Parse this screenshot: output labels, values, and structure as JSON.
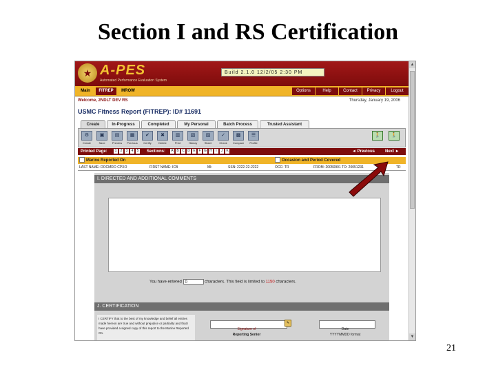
{
  "slide": {
    "title": "Section I and RS Certification",
    "page_number": "21"
  },
  "app": {
    "logo": "A-PES",
    "logo_subtitle": "Automated Performance Evaluation System",
    "build": "Build 2.1.0   12/2/05   2:30 PM"
  },
  "menu": {
    "left_tabs": [
      {
        "label": "Main",
        "bg": "#f0b428",
        "fg": "#000000"
      },
      {
        "label": "FITREP",
        "bg": "#7d0c0c",
        "fg": "#ffffff"
      },
      {
        "label": "MROW",
        "bg": "#f0b428",
        "fg": "#000000"
      }
    ],
    "right_items": [
      "Options",
      "Help",
      "Contact",
      "Privacy",
      "Logout"
    ]
  },
  "welcome": "Welcome, 2NDLT DEV RS",
  "date": "Thursday, January 19, 2006",
  "report_title": "USMC Fitness Report (FITREP): ID# 11691",
  "tabs": [
    {
      "label": "Create",
      "active": true
    },
    {
      "label": "In-Progress",
      "active": false
    },
    {
      "label": "Completed",
      "active": false
    },
    {
      "label": "My Personal",
      "active": false
    },
    {
      "label": "Batch Process",
      "active": false
    },
    {
      "label": "Trusted Assistant",
      "active": false
    }
  ],
  "toolbar": {
    "tools": [
      {
        "icon": "create-icon",
        "glyph": "⚙",
        "label": "Create"
      },
      {
        "icon": "save-icon",
        "glyph": "▣",
        "label": "Save"
      },
      {
        "icon": "preview-icon",
        "glyph": "▤",
        "label": "Preview"
      },
      {
        "icon": "previous-icon",
        "glyph": "▦",
        "label": "Previous"
      },
      {
        "icon": "certify-icon",
        "glyph": "✔",
        "label": "Certify"
      },
      {
        "icon": "delete-icon",
        "glyph": "✖",
        "label": "Delete"
      },
      {
        "icon": "print-icon",
        "glyph": "▥",
        "label": "Print"
      },
      {
        "icon": "history-icon",
        "glyph": "▧",
        "label": "History"
      },
      {
        "icon": "sheet-icon",
        "glyph": "▨",
        "label": "Sheet"
      },
      {
        "icon": "check-icon",
        "glyph": "✓",
        "label": "Check"
      },
      {
        "icon": "compare-icon",
        "glyph": "▩",
        "label": "Compare"
      },
      {
        "icon": "profile-icon",
        "glyph": "☰",
        "label": "Profile"
      }
    ],
    "right_tools": [
      {
        "icon": "walk-left-icon",
        "glyph": "🚶"
      },
      {
        "icon": "walk-right-icon",
        "glyph": "🚶"
      }
    ]
  },
  "navbar": {
    "printed_page_label": "Printed Page:",
    "printed_pages": [
      "1",
      "2",
      "3",
      "4",
      "5"
    ],
    "sections_label": "Sections:",
    "sections": [
      "A",
      "B",
      "C",
      "D",
      "E",
      "F",
      "G",
      "H",
      "I",
      "J",
      "K"
    ],
    "previous": "◄ Previous",
    "next": "Next ►"
  },
  "marine_bar": {
    "left": "Marine Reported On",
    "right": "Occasion and Period Covered"
  },
  "info_row": [
    "LAST NAME: DOCMRO CPXO",
    "FIRST NAME: ICB",
    "MI:",
    "SSN: 2222-22-2222",
    "OCC: TR",
    "FROM: 20050901 TO: 20051231",
    "TR"
  ],
  "section_i": {
    "header": "I. DIRECTED AND ADDITIONAL COMMENTS",
    "comments_value": "",
    "counter_prefix": "You have entered",
    "counter_value": "0",
    "counter_suffix": "characters. This field is limited to",
    "limit": "1150",
    "limit_suffix": "characters."
  },
  "section_j": {
    "header": "J. CERTIFICATION",
    "cert_text": "I CERTIFY that to the best of my knowledge and belief all entries made hereon are true and without prejudice or partiality and that I have provided a signed copy of this report to the Marine Reported On.",
    "signature_label": "Signature of",
    "signature_role": "Reporting Senior",
    "date_label": "Date",
    "date_format": "YYYYMMDD format"
  }
}
